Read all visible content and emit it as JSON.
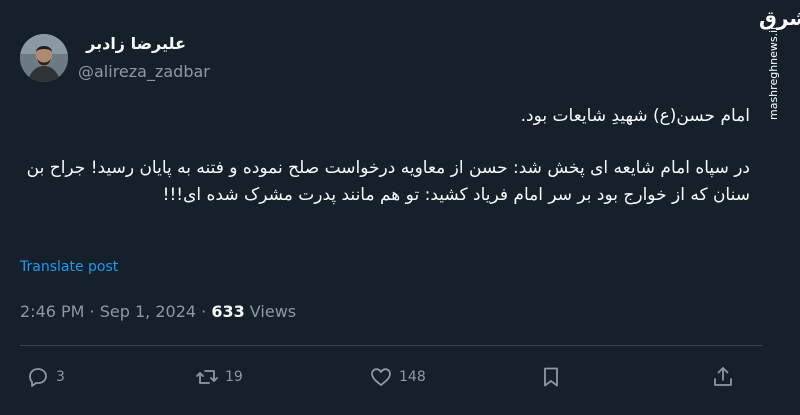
{
  "author": {
    "name": "علیرضا زادبر",
    "handle": "@alireza_zadbar"
  },
  "watermark": {
    "logo_text": "مشرق",
    "url": "mashreghnews.ir"
  },
  "tweet": {
    "paragraph1": "امام حسن(ع) شهیدِ شایعات بود.",
    "paragraph2": "در سپاه امام شایعه ای پخش شد: حسن از معاویه درخواست صلح نموده و فتنه به پایان رسید! جراح بن سنان که از خوارج بود بر سر امام فریاد کشید: تو هم مانند پدرت مشرک شده ای!!!"
  },
  "translate_label": "Translate post",
  "meta": {
    "time": "2:46 PM",
    "separator1": " · ",
    "date": "Sep 1, 2024",
    "separator2": " · ",
    "views_count": "633",
    "views_label": " Views"
  },
  "actions": {
    "replies": "3",
    "reposts": "19",
    "likes": "148"
  },
  "icons": [
    "reply-icon",
    "repost-icon",
    "like-icon",
    "bookmark-icon",
    "share-icon"
  ],
  "colors": {
    "background": "#15202b",
    "text": "#f7f9f9",
    "secondary": "#8b98a5",
    "link": "#1d9bf0",
    "divider": "#38444d"
  }
}
